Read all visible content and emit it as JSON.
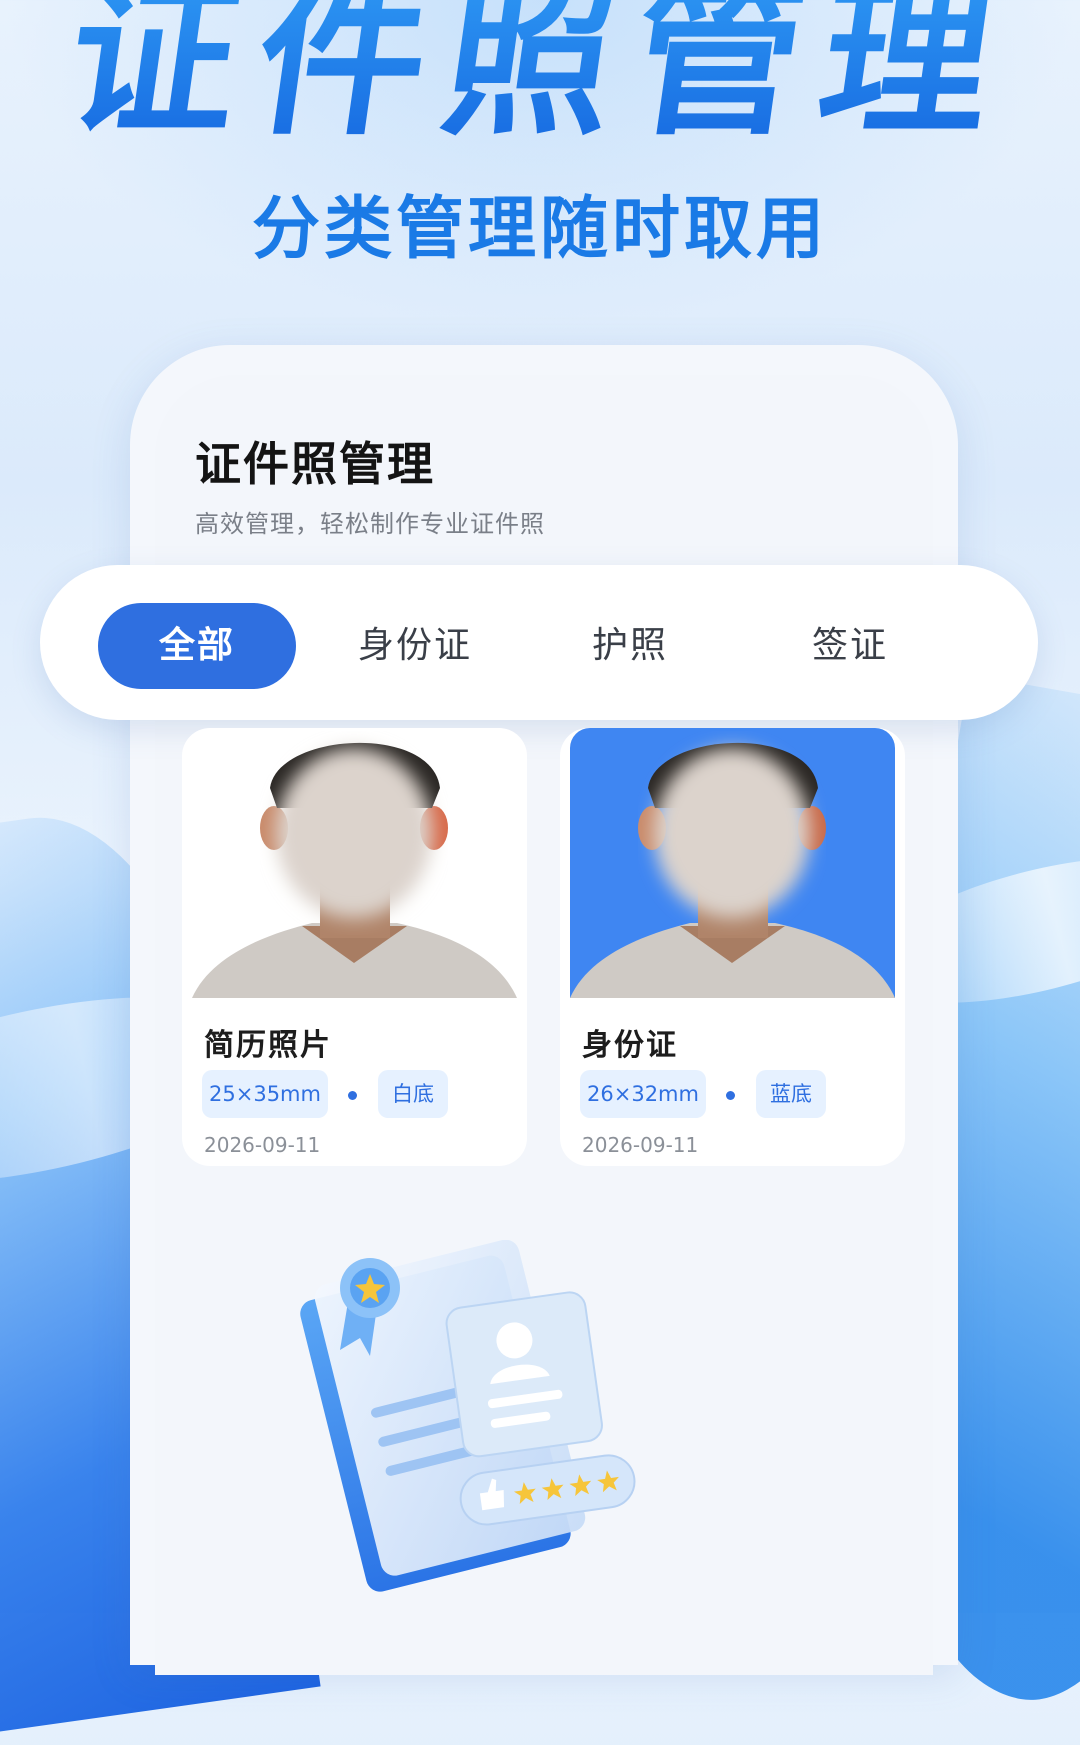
{
  "hero": {
    "title": "证件照管理",
    "subtitle": "分类管理随时取用"
  },
  "screen": {
    "title": "证件照管理",
    "subtitle": "高效管理，轻松制作专业证件照"
  },
  "tabs": [
    {
      "label": "全部",
      "active": true
    },
    {
      "label": "身份证",
      "active": false
    },
    {
      "label": "护照",
      "active": false
    },
    {
      "label": "签证",
      "active": false
    }
  ],
  "photos": [
    {
      "name": "简历照片",
      "size": "25×35mm",
      "background": "白底",
      "date": "2026-09-11",
      "bg_color": "#ffffff"
    },
    {
      "name": "身份证",
      "size": "26×32mm",
      "background": "蓝底",
      "date": "2026-09-11",
      "bg_color": "#3f86f2"
    }
  ],
  "colors": {
    "accent": "#2f6fe0",
    "chip_bg": "#e6f1ff",
    "hero_blue": "#1a7ae6"
  },
  "icons": {
    "illustration": "id-card-certificate-illustration"
  }
}
